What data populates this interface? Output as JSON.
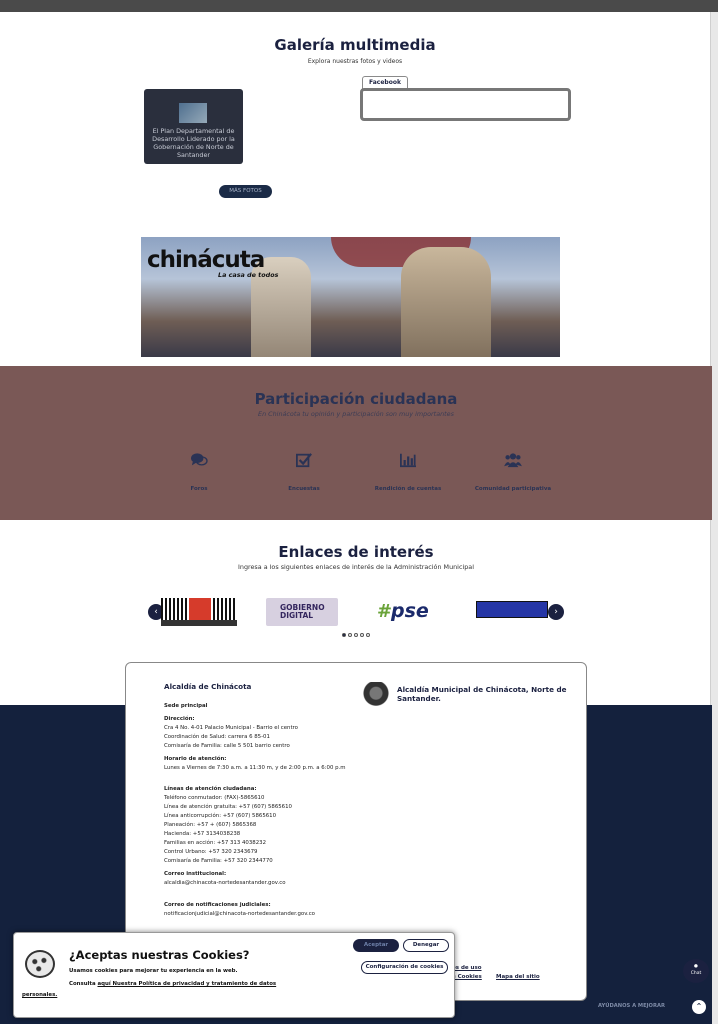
{
  "gallery": {
    "title": "Galería multimedia",
    "subtitle": "Explora nuestras fotos y videos",
    "photo_caption": "El Plan Departamental de Desarrollo Liderado por la Gobernación de Norte de Santander",
    "facebook_tab": "Facebook",
    "more_button": "MÁS FOTOS"
  },
  "banner": {
    "brand": "chinácuta",
    "tagline": "La casa de todos"
  },
  "participation": {
    "title": "Participación ciudadana",
    "subtitle": "En Chinácota tu opinión y participación son muy importantes",
    "items": [
      {
        "label": "Foros",
        "icon": "comments-icon"
      },
      {
        "label": "Encuestas",
        "icon": "checkbox-icon"
      },
      {
        "label": "Rendición de cuentas",
        "icon": "bar-chart-icon"
      },
      {
        "label": "Comunidad participativa",
        "icon": "users-icon"
      }
    ]
  },
  "links": {
    "title": "Enlaces de interés",
    "subtitle": "Ingresa a los siguientes enlaces de interés de la Administración Municipal",
    "logos": [
      "GOBIERNO DIGITAL",
      "pse"
    ],
    "prev": "‹",
    "next": "›"
  },
  "footer": {
    "name": "Alcaldía de Chinácota",
    "right_title": "Alcaldía Municipal de Chinácota, Norte de Santander.",
    "sede_label": "Sede principal",
    "direccion_label": "Dirección:",
    "direccion": [
      "Cra 4 No. 4-01 Palacio Municipal - Barrio el centro",
      "Coordinación de Salud: carrera 6 85-01",
      "Comisaría de Familia: calle 5 501 barrio centro"
    ],
    "horario_label": "Horario de atención:",
    "horario": "Lunes a Viernes de 7:30 a.m. a 11:30 m, y de 2:00 p.m. a 6:00 p.m",
    "lineas_label": "Líneas de atención ciudadana:",
    "lineas": [
      "Teléfono conmutador: (FAX)-5865610",
      "Línea de atención gratuita: +57 (607) 5865610",
      "Línea anticorrupción: +57 (607) 5865610",
      "Planeación: +57 + (607) 5865368",
      "Hacienda: +57 3134038238",
      "Familias en acción: +57 313 4038232",
      "Control Urbano: +57 320 2343679",
      "Comisaría de Familia: +57 320 2344770"
    ],
    "correo_label": "Correo institucional:",
    "correo": "alcaldia@chinacota-nortedesantander.gov.co",
    "notif_label": "Correo de notificaciones judiciales:",
    "notif": "notificacionjudicial@chinacota-nortedesantander.gov.co",
    "terms_a": "os de uso",
    "terms_b": "e Cookies",
    "sitemap": "Mapa del sitio"
  },
  "cookies": {
    "title": "¿Aceptas nuestras Cookies?",
    "line1": "Usamos cookies para mejorar tu experiencia en la web.",
    "line2_prefix": "Consulta ",
    "line2_link": "aquí Nuestra Política de privacidad y tratamiento de datos",
    "line3": "personales.",
    "accept": "Aceptar",
    "deny": "Denegar",
    "config": "Configuración de cookies"
  },
  "widgets": {
    "chat_label": "Chat",
    "help_label": "AYÚDANOS A MEJORAR",
    "totop": "⌃"
  }
}
